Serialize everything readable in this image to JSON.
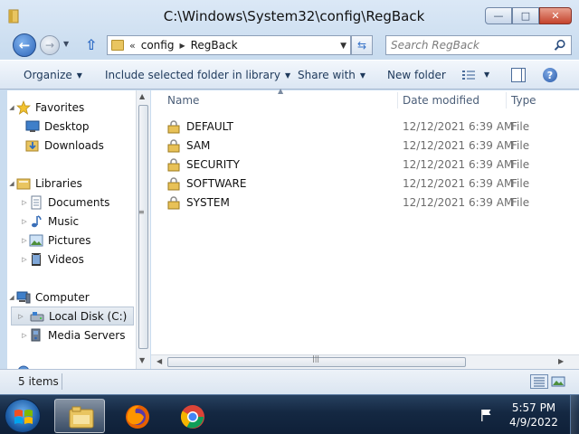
{
  "window": {
    "title": "C:\\Windows\\System32\\config\\RegBack",
    "min_icon": "minimize-icon",
    "max_icon": "maximize-icon",
    "close_icon": "close-icon",
    "min_glyph": "—",
    "max_glyph": "□",
    "close_glyph": "✕"
  },
  "address": {
    "overflow": "«",
    "crumbs": [
      "config",
      "RegBack"
    ],
    "separator": "▶",
    "search_placeholder": "Search RegBack"
  },
  "toolbar": {
    "organize": "Organize",
    "include": "Include selected folder in library",
    "share": "Share with",
    "new_folder": "New folder",
    "help": "?"
  },
  "nav": {
    "favorites": "Favorites",
    "desktop": "Desktop",
    "downloads": "Downloads",
    "libraries": "Libraries",
    "documents": "Documents",
    "music": "Music",
    "pictures": "Pictures",
    "videos": "Videos",
    "computer": "Computer",
    "local_disk": "Local Disk (C:)",
    "media_servers": "Media Servers"
  },
  "columns": {
    "name": "Name",
    "date": "Date modified",
    "type": "Type"
  },
  "files": [
    {
      "name": "DEFAULT",
      "date": "12/12/2021 6:39 AM",
      "type": "File"
    },
    {
      "name": "SAM",
      "date": "12/12/2021 6:39 AM",
      "type": "File"
    },
    {
      "name": "SECURITY",
      "date": "12/12/2021 6:39 AM",
      "type": "File"
    },
    {
      "name": "SOFTWARE",
      "date": "12/12/2021 6:39 AM",
      "type": "File"
    },
    {
      "name": "SYSTEM",
      "date": "12/12/2021 6:39 AM",
      "type": "File"
    }
  ],
  "status": {
    "count": "5 items"
  },
  "taskbar": {
    "time": "5:57 PM",
    "date": "4/9/2022"
  },
  "colors": {
    "accent": "#2c64b8",
    "folder": "#e9c560",
    "taskbar": "#142842"
  }
}
